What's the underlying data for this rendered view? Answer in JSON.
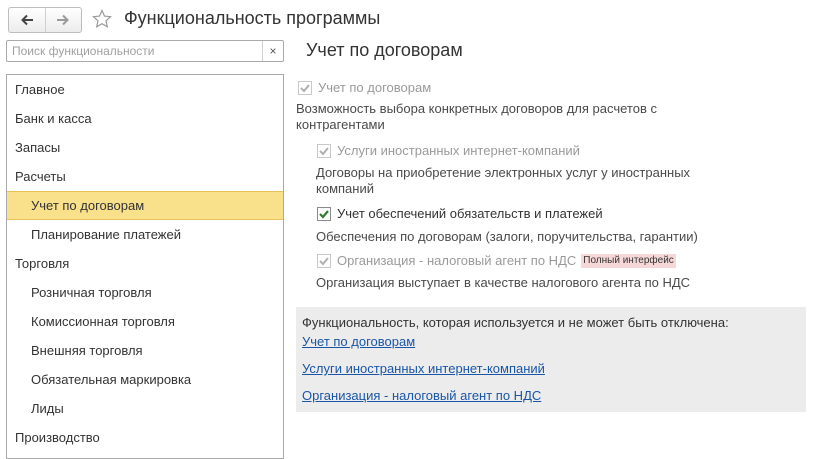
{
  "header": {
    "back_icon": "arrow-left-icon",
    "forward_icon": "arrow-right-icon",
    "favorite_icon": "star-icon",
    "title": "Функциональность программы"
  },
  "search": {
    "placeholder": "Поиск функциональности",
    "value": "",
    "clear_label": "×"
  },
  "sidebar": {
    "items": [
      {
        "label": "Главное"
      },
      {
        "label": "Банк и касса"
      },
      {
        "label": "Запасы"
      },
      {
        "label": "Расчеты"
      },
      {
        "label": "Учет по договорам"
      },
      {
        "label": "Планирование платежей"
      },
      {
        "label": "Торговля"
      },
      {
        "label": "Розничная торговля"
      },
      {
        "label": "Комиссионная торговля"
      },
      {
        "label": "Внешняя торговля"
      },
      {
        "label": "Обязательная маркировка"
      },
      {
        "label": "Лиды"
      },
      {
        "label": "Производство"
      }
    ],
    "selected_color": "#f9e08b"
  },
  "main": {
    "title": "Учет по договорам",
    "options": [
      {
        "label": "Учет по договорам",
        "checked": true,
        "enabled": false,
        "description": "Возможность выбора конкретных договоров для расчетов с контрагентами"
      },
      {
        "label": "Услуги иностранных интернет-компаний",
        "checked": true,
        "enabled": false,
        "description": "Договоры на приобретение электронных услуг у иностранных компаний"
      },
      {
        "label": "Учет обеспечений обязательств и платежей",
        "checked": true,
        "enabled": true,
        "description": "Обеспечения по договорам (залоги, поручительства, гарантии)"
      },
      {
        "label": "Организация - налоговый агент по НДС",
        "checked": true,
        "enabled": false,
        "badge": "Полный интерфейс",
        "description": "Организация выступает в качестве налогового агента по НДС"
      }
    ],
    "fixed_panel": {
      "caption": "Функциональность, которая используется и не может быть отключена:",
      "links": [
        "Учет по договорам",
        "Услуги иностранных интернет-компаний",
        "Организация - налоговый агент по НДС"
      ]
    }
  },
  "colors": {
    "accent_check": "#2e7d32",
    "disabled_check": "#b0b0b0",
    "link": "#1a56a8",
    "badge_bg": "#f7d8d8",
    "panel_bg": "#ececec"
  }
}
